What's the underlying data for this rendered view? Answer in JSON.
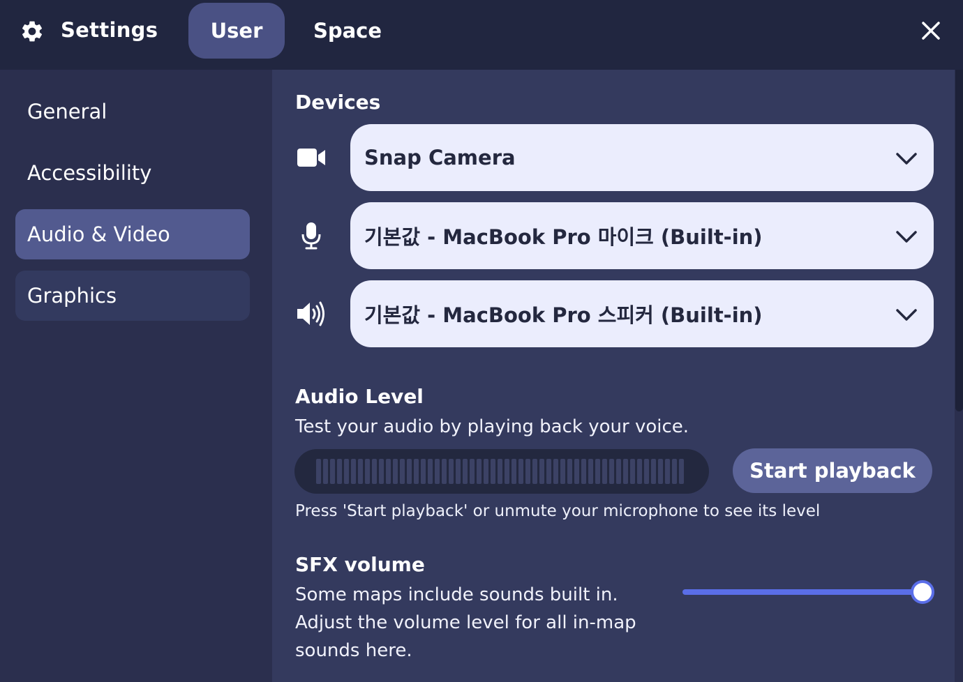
{
  "header": {
    "title": "Settings",
    "tabs": [
      {
        "label": "User",
        "active": true
      },
      {
        "label": "Space",
        "active": false
      }
    ]
  },
  "sidebar": {
    "items": [
      {
        "label": "General",
        "active": false
      },
      {
        "label": "Accessibility",
        "active": false
      },
      {
        "label": "Audio & Video",
        "active": true
      },
      {
        "label": "Graphics",
        "active": false
      }
    ]
  },
  "devices": {
    "title": "Devices",
    "camera": {
      "icon": "video-camera-icon",
      "selected": "Snap Camera"
    },
    "microphone": {
      "icon": "microphone-icon",
      "selected": "기본값 - MacBook Pro 마이크 (Built-in)"
    },
    "speaker": {
      "icon": "speaker-icon",
      "selected": "기본값 - MacBook Pro 스피커 (Built-in)"
    }
  },
  "audio_level": {
    "title": "Audio Level",
    "description": "Test your audio by playing back your voice.",
    "button_label": "Start playback",
    "hint": "Press 'Start playback' or unmute your microphone to see its level",
    "level": 0
  },
  "sfx": {
    "title": "SFX volume",
    "description": "Some maps include sounds built in. Adjust the volume level for all in-map sounds here.",
    "volume": 1.0
  },
  "colors": {
    "header_bg": "#212640",
    "panel_bg": "#343a5e",
    "active_tab": "#4a5184",
    "active_side": "#525a8f",
    "dropdown_bg": "#ebedfd",
    "accent": "#5a6ee8"
  }
}
